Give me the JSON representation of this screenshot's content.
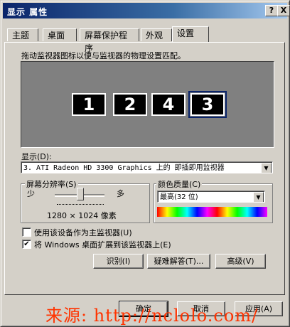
{
  "window": {
    "title": "显示 属性",
    "help_glyph": "?",
    "close_glyph": "X"
  },
  "tabs": [
    {
      "label": "主题"
    },
    {
      "label": "桌面"
    },
    {
      "label": "屏幕保护程序"
    },
    {
      "label": "外观"
    },
    {
      "label": "设置"
    }
  ],
  "active_tab": "设置",
  "settings": {
    "description": "拖动监视器图标以便与监视器的物理设置匹配。",
    "monitors": [
      "1",
      "2",
      "4",
      "3"
    ],
    "selected_monitor": "3",
    "display_label": "显示(D):",
    "display_value": "3. ATI Radeon HD 3300 Graphics 上的 即插即用监视器",
    "resolution": {
      "group_title": "屏幕分辨率(S)",
      "less_label": "少",
      "more_label": "多",
      "value_text": "1280 × 1024 像素"
    },
    "color_quality": {
      "group_title": "颜色质量(C)",
      "selected": "最高(32 位)"
    },
    "checkboxes": [
      {
        "label": "使用该设备作为主监视器(U)",
        "checked": false
      },
      {
        "label": "将 Windows 桌面扩展到该监视器上(E)",
        "checked": true
      }
    ],
    "buttons": {
      "identify": "识别(I)",
      "troubleshoot": "疑难解答(T)...",
      "advanced": "高级(V)"
    }
  },
  "footer": {
    "ok": "确定",
    "cancel": "取消",
    "apply": "应用(A)"
  },
  "watermark": "来源: http://nclolo.com/"
}
